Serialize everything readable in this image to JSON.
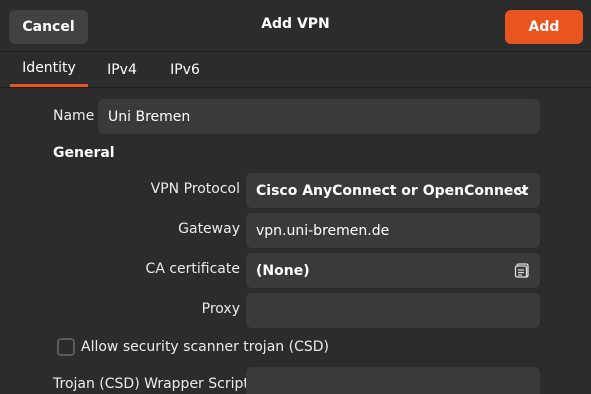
{
  "header": {
    "cancel_label": "Cancel",
    "title": "Add VPN",
    "add_label": "Add",
    "accent_color": "#e95420"
  },
  "tabs": [
    {
      "label": "Identity",
      "active": true
    },
    {
      "label": "IPv4",
      "active": false
    },
    {
      "label": "IPv6",
      "active": false
    }
  ],
  "form": {
    "name_label": "Name",
    "name_value": "Uni Bremen",
    "section_general": "General",
    "vpn_protocol_label": "VPN Protocol",
    "vpn_protocol_value": "Cisco AnyConnect or OpenConnect",
    "gateway_label": "Gateway",
    "gateway_value": "vpn.uni-bremen.de",
    "ca_cert_label": "CA certificate",
    "ca_cert_value": "(None)",
    "proxy_label": "Proxy",
    "proxy_value": "",
    "csd_checkbox_label": "Allow security scanner trojan (CSD)",
    "csd_checked": false,
    "csd_wrapper_label": "Trojan (CSD) Wrapper Script",
    "csd_wrapper_value": ""
  },
  "icons": {
    "dropdown": "chevron-down-icon",
    "file_chooser": "file-chooser-icon"
  }
}
